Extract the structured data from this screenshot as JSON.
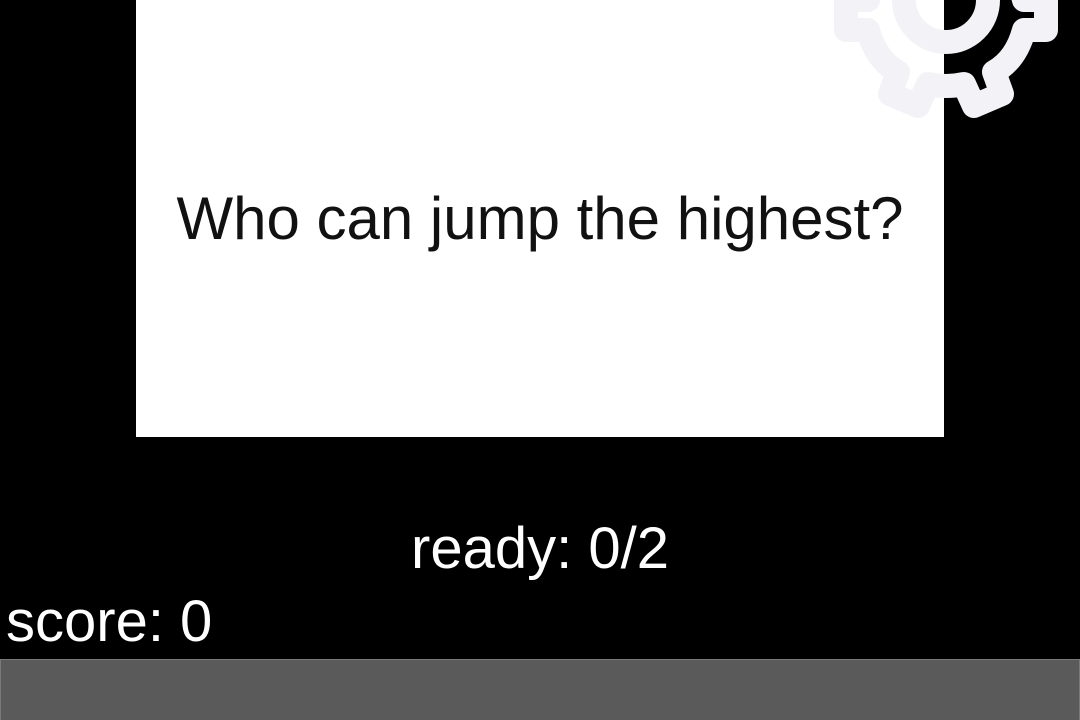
{
  "question": {
    "text": "Who can jump the highest?"
  },
  "status": {
    "ready_text": "ready: 0/2",
    "score_text": "score: 0"
  },
  "icons": {
    "settings": "gear-icon"
  },
  "colors": {
    "background": "#000000",
    "card": "#ffffff",
    "question_text": "#111111",
    "status_text": "#ffffff",
    "bottom_bar": "#5a5a5a",
    "gear": "#f3f3f7"
  }
}
